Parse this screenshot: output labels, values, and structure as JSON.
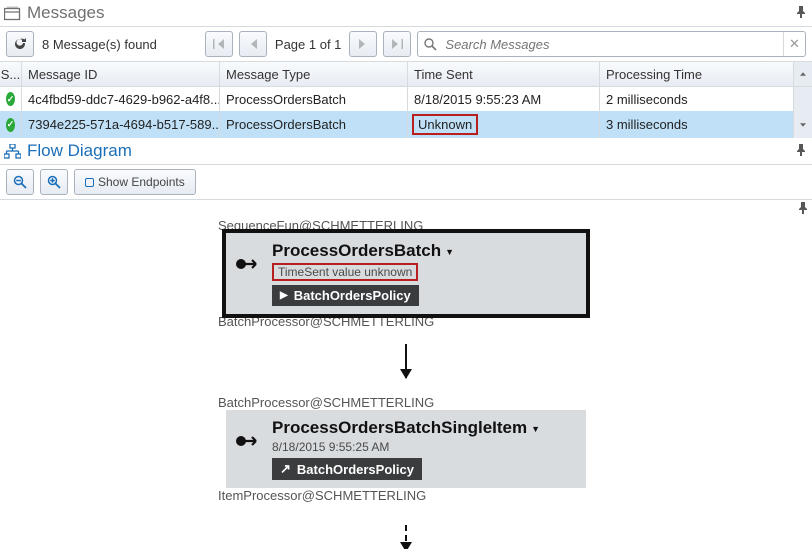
{
  "messages_panel": {
    "title": "Messages",
    "count_text": "8 Message(s) found",
    "page_text": "Page 1 of 1",
    "search_placeholder": "Search Messages",
    "columns": {
      "status": "S...",
      "id": "Message ID",
      "type": "Message Type",
      "time": "Time Sent",
      "proc": "Processing Time"
    },
    "rows": [
      {
        "status": "ok",
        "id": "4c4fbd59-ddc7-4629-b962-a4f8...",
        "type": "ProcessOrdersBatch",
        "time": "8/18/2015 9:55:23 AM",
        "proc": "2 milliseconds",
        "selected": false
      },
      {
        "status": "ok",
        "id": "7394e225-571a-4694-b517-589...",
        "type": "ProcessOrdersBatch",
        "time": "Unknown",
        "proc": "3 milliseconds",
        "selected": true,
        "time_highlight": true
      }
    ]
  },
  "flow_panel": {
    "title": "Flow Diagram",
    "show_endpoints": "Show Endpoints",
    "nodes": [
      {
        "endpoint_top": "SequenceFun@SCHMETTERLING",
        "title": "ProcessOrdersBatch",
        "subtitle": "TimeSent value unknown",
        "policy": "BatchOrdersPolicy",
        "endpoint_bottom": "BatchProcessor@SCHMETTERLING",
        "selected": true,
        "sub_highlight": true,
        "policy_icon": "play"
      },
      {
        "endpoint_top": "BatchProcessor@SCHMETTERLING",
        "title": "ProcessOrdersBatchSingleItem",
        "subtitle": "8/18/2015 9:55:25 AM",
        "policy": "BatchOrdersPolicy",
        "endpoint_bottom": "ItemProcessor@SCHMETTERLING",
        "selected": false,
        "sub_highlight": false,
        "policy_icon": "uparrow"
      }
    ]
  }
}
